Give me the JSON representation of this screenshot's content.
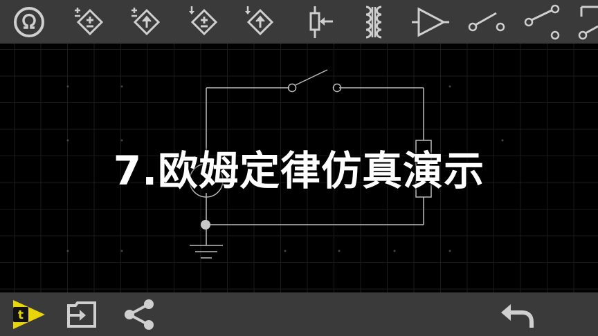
{
  "toolbar_top": {
    "items": [
      {
        "name": "ohmmeter-icon"
      },
      {
        "name": "voltage-source-icon"
      },
      {
        "name": "voltage-source-arrow-icon"
      },
      {
        "name": "current-source-icon"
      },
      {
        "name": "current-source-arrow-icon"
      },
      {
        "name": "potentiometer-icon"
      },
      {
        "name": "transformer-icon"
      },
      {
        "name": "op-amp-icon"
      },
      {
        "name": "switch-spst-icon"
      },
      {
        "name": "switch-spdt-icon"
      },
      {
        "name": "more-components-icon"
      }
    ]
  },
  "toolbar_bottom": {
    "items": [
      {
        "name": "text-tool-icon"
      },
      {
        "name": "import-icon"
      },
      {
        "name": "share-icon"
      },
      {
        "name": "undo-icon"
      }
    ]
  },
  "overlay": {
    "title": "7.欧姆定律仿真演示"
  },
  "colors": {
    "toolbar_bg": "#3a3a3a",
    "icon": "#cfcfcf",
    "wire": "#bdbdbd",
    "accent": "#e8d60a"
  }
}
